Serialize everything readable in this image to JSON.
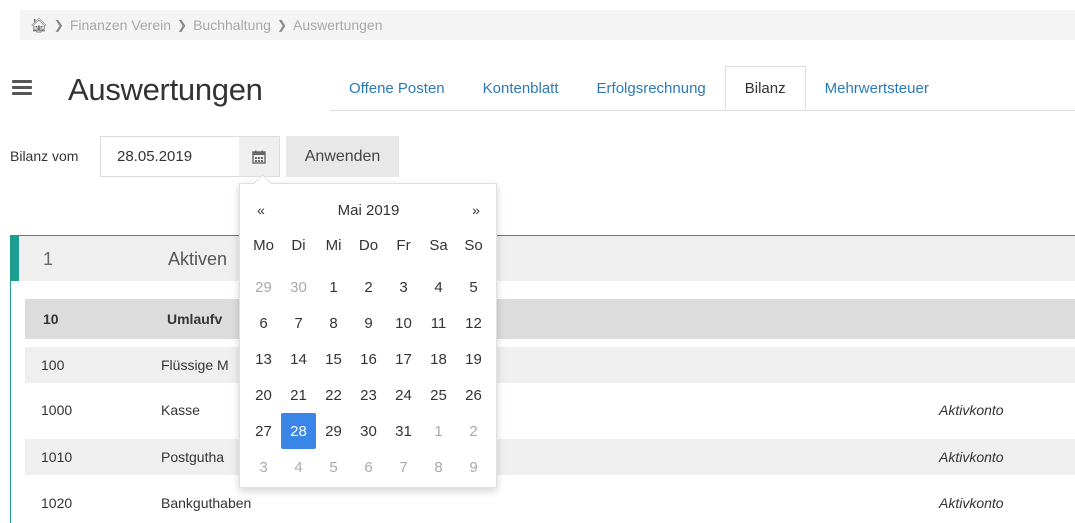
{
  "breadcrumb": {
    "items": [
      "Finanzen Verein",
      "Buchhaltung",
      "Auswertungen"
    ]
  },
  "header": {
    "title": "Auswertungen"
  },
  "tabs": [
    {
      "label": "Offene Posten",
      "active": false
    },
    {
      "label": "Kontenblatt",
      "active": false
    },
    {
      "label": "Erfolgsrechnung",
      "active": false
    },
    {
      "label": "Bilanz",
      "active": true
    },
    {
      "label": "Mehrwertsteuer",
      "active": false
    }
  ],
  "filter": {
    "label": "Bilanz vom",
    "date_value": "28.05.2019",
    "apply_label": "Anwenden"
  },
  "datepicker": {
    "prev": "«",
    "next": "»",
    "month_label": "Mai 2019",
    "weekdays": [
      "Mo",
      "Di",
      "Mi",
      "Do",
      "Fr",
      "Sa",
      "So"
    ],
    "days": [
      {
        "d": "29",
        "muted": true
      },
      {
        "d": "30",
        "muted": true
      },
      {
        "d": "1"
      },
      {
        "d": "2"
      },
      {
        "d": "3"
      },
      {
        "d": "4"
      },
      {
        "d": "5"
      },
      {
        "d": "6"
      },
      {
        "d": "7"
      },
      {
        "d": "8"
      },
      {
        "d": "9"
      },
      {
        "d": "10"
      },
      {
        "d": "11"
      },
      {
        "d": "12"
      },
      {
        "d": "13"
      },
      {
        "d": "14"
      },
      {
        "d": "15"
      },
      {
        "d": "16"
      },
      {
        "d": "17"
      },
      {
        "d": "18"
      },
      {
        "d": "19"
      },
      {
        "d": "20"
      },
      {
        "d": "21"
      },
      {
        "d": "22"
      },
      {
        "d": "23"
      },
      {
        "d": "24"
      },
      {
        "d": "25"
      },
      {
        "d": "26"
      },
      {
        "d": "27"
      },
      {
        "d": "28",
        "selected": true
      },
      {
        "d": "29"
      },
      {
        "d": "30"
      },
      {
        "d": "31"
      },
      {
        "d": "1",
        "muted": true
      },
      {
        "d": "2",
        "muted": true
      },
      {
        "d": "3",
        "muted": true
      },
      {
        "d": "4",
        "muted": true
      },
      {
        "d": "5",
        "muted": true
      },
      {
        "d": "6",
        "muted": true
      },
      {
        "d": "7",
        "muted": true
      },
      {
        "d": "8",
        "muted": true
      },
      {
        "d": "9",
        "muted": true
      }
    ]
  },
  "balance": {
    "section_number": "1",
    "section_name": "Aktiven",
    "rows": [
      {
        "num": "10",
        "name": "Umlaufv",
        "type": ""
      },
      {
        "num": "100",
        "name": "Flüssige M",
        "type": ""
      },
      {
        "num": "1000",
        "name": "Kasse",
        "type": "Aktivkonto"
      },
      {
        "num": "1010",
        "name": "Postgutha",
        "type": "Aktivkonto"
      },
      {
        "num": "1020",
        "name": "Bankguthaben",
        "type": "Aktivkonto"
      }
    ]
  },
  "colors": {
    "accent": "#1e9e8f",
    "link": "#2a7ab8",
    "selected_day": "#3a86e8"
  },
  "icons": {
    "home": "home-icon",
    "calendar": "calendar-icon",
    "menu": "hamburger-menu-icon"
  }
}
